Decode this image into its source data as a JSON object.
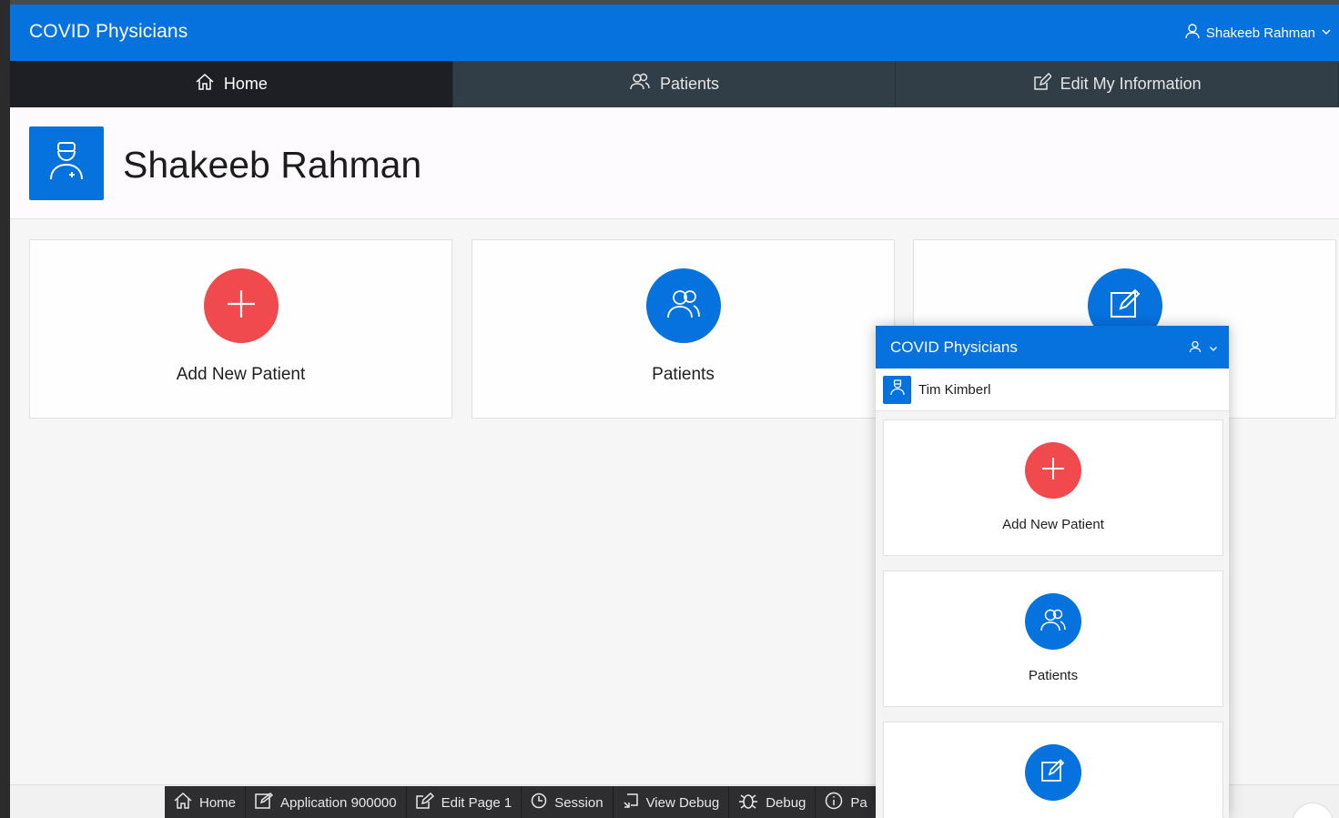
{
  "header": {
    "title": "COVID Physicians",
    "user_name": "Shakeeb Rahman"
  },
  "nav": {
    "tabs": [
      {
        "label": "Home",
        "icon": "home-icon",
        "active": true
      },
      {
        "label": "Patients",
        "icon": "users-icon",
        "active": false
      },
      {
        "label": "Edit My Information",
        "icon": "edit-icon",
        "active": false
      }
    ]
  },
  "hero": {
    "name": "Shakeeb Rahman",
    "icon": "doctor-icon"
  },
  "cards": [
    {
      "label": "Add New Patient",
      "icon": "plus-icon",
      "color": "#f04a4f"
    },
    {
      "label": "Patients",
      "icon": "users-icon",
      "color": "#0572de"
    },
    {
      "label": "",
      "icon": "edit-icon",
      "color": "#0572de"
    }
  ],
  "devbar": {
    "items": [
      {
        "label": "Home",
        "icon": "home-icon"
      },
      {
        "label": "Application 900000",
        "icon": "edit-box-icon"
      },
      {
        "label": "Edit Page 1",
        "icon": "edit-icon"
      },
      {
        "label": "Session",
        "icon": "clock-icon"
      },
      {
        "label": "View Debug",
        "icon": "view-debug-icon"
      },
      {
        "label": "Debug",
        "icon": "bug-icon"
      },
      {
        "label": "Pa",
        "icon": "info-icon"
      }
    ]
  },
  "mobile": {
    "title": "COVID Physicians",
    "user_name": "Tim Kimberl",
    "cards": [
      {
        "label": "Add New Patient",
        "icon": "plus-icon",
        "color": "#f04a4f"
      },
      {
        "label": "Patients",
        "icon": "users-icon",
        "color": "#0572de"
      },
      {
        "label": "",
        "icon": "edit-icon",
        "color": "#0572de"
      }
    ]
  },
  "colors": {
    "brand": "#0572de",
    "accent_red": "#f04a4f",
    "nav_active": "#1d1f24",
    "nav_bg": "#313e48"
  }
}
